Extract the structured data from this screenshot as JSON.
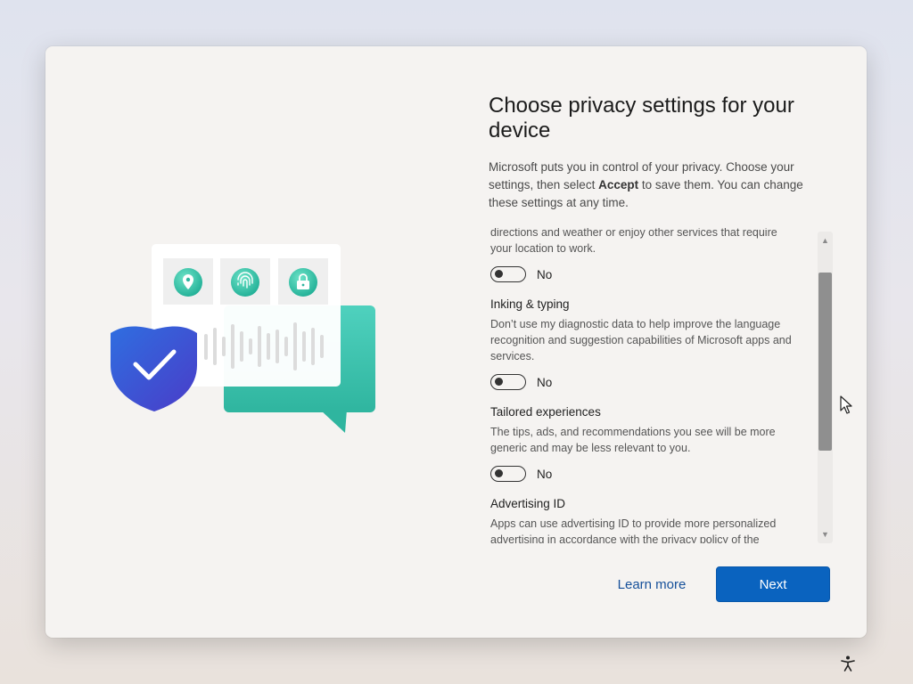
{
  "dialog": {
    "title": "Choose privacy settings for your device",
    "intro_before": "Microsoft puts you in control of your privacy. Choose your settings, then select ",
    "intro_bold": "Accept",
    "intro_after": " to save them. You can change these settings at any time."
  },
  "settings": {
    "location_partial": {
      "desc": "directions and weather or enjoy other services that require your location to work.",
      "state": "No"
    },
    "inking": {
      "title": "Inking & typing",
      "desc": "Don’t use my diagnostic data to help improve the language recognition and suggestion capabilities of Microsoft apps and services.",
      "state": "No"
    },
    "tailored": {
      "title": "Tailored experiences",
      "desc": "The tips, ads, and recommendations you see will be more generic and may be less relevant to you.",
      "state": "No"
    },
    "advertising": {
      "title": "Advertising ID",
      "desc": "Apps can use advertising ID to provide more personalized advertising in accordance with the privacy policy of the"
    }
  },
  "buttons": {
    "learn_more": "Learn more",
    "next": "Next"
  },
  "icons": [
    "location-icon",
    "fingerprint-icon",
    "lock-icon",
    "shield-check-icon",
    "accessibility-icon",
    "mouse-cursor-icon",
    "scroll-up-icon",
    "scroll-down-icon"
  ],
  "colors": {
    "accent": "#0a63bf",
    "link": "#16509a",
    "teal": "#3dc5b0",
    "shield": "#3355d8"
  }
}
